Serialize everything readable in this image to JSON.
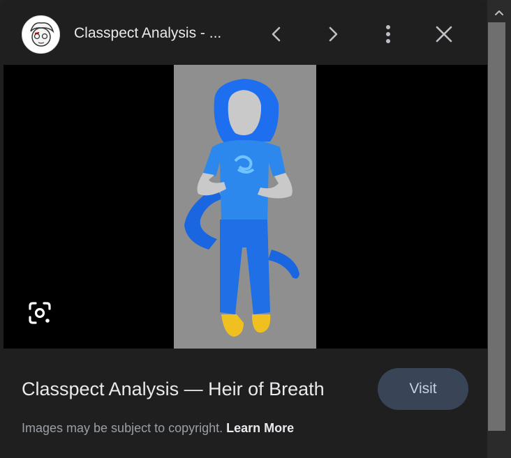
{
  "header": {
    "title": "Classpect Analysis - ...",
    "icons": {
      "avatar": "site-avatar",
      "prev": "chevron-left-icon",
      "next": "chevron-right-icon",
      "more": "more-vert-icon",
      "close": "close-icon"
    }
  },
  "image": {
    "caption": "Classpect Analysis — Heir of Breath",
    "lens_icon": "lens-icon"
  },
  "actions": {
    "visit_label": "Visit"
  },
  "footer": {
    "copyright_text": "Images may be subject to copyright. ",
    "learn_more_label": "Learn More"
  },
  "colors": {
    "panel_bg": "#1f1f1f",
    "visit_bg": "#394457",
    "viewer_bg": "#000000",
    "image_bg": "#8f8f8f"
  }
}
